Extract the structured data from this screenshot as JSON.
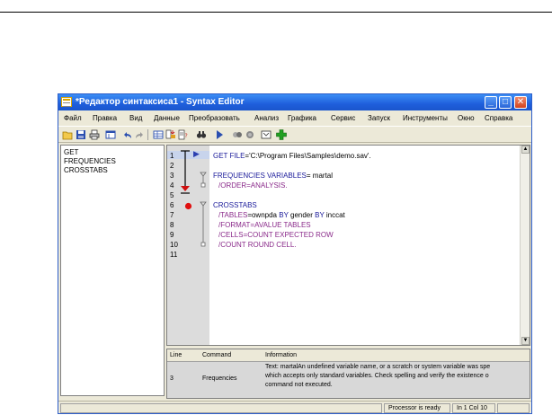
{
  "window": {
    "title": "*Редактор синтаксиса1 - Syntax Editor",
    "minimize": "_",
    "maximize": "□",
    "close": "✕"
  },
  "menu": [
    "Файл",
    "Правка",
    "Вид",
    "Данные",
    "Преобразовать",
    "Анализ",
    "Графика",
    "Сервис",
    "Запуск",
    "Инструменты",
    "Окно",
    "Справка"
  ],
  "toolbar_icons": [
    "open-icon",
    "save-icon",
    "print-icon",
    "dialog-recall-icon",
    "undo-icon",
    "redo-icon",
    "goto-data-icon",
    "goto-case-icon",
    "variables-icon",
    "find-icon",
    "run-icon",
    "step-icon",
    "breakpoint-icon",
    "bookmark-icon",
    "add-icon"
  ],
  "navigator": [
    "GET",
    "FREQUENCIES",
    "CROSSTABS"
  ],
  "editor": {
    "line_numbers": [
      "1",
      "2",
      "3",
      "4",
      "5",
      "6",
      "7",
      "8",
      "9",
      "10",
      "11"
    ],
    "lines": [
      {
        "kw": "GET FILE",
        "rest": "='C:\\Program Files\\Samples\\demo.sav'."
      },
      {
        "kw": "FREQUENCIES VARIABLES",
        "rest": "= martal"
      },
      {
        "kw": "/ORDER",
        "rest": "=ANALYSIS."
      },
      {
        "kw": "CROSSTABS",
        "rest": ""
      },
      {
        "kw": "/TABLES",
        "rest": "=ownpda ",
        "kw2": "BY",
        "rest2": " gender ",
        "kw3": "BY",
        "rest3": " inccat"
      },
      {
        "kw": "/FORMAT",
        "rest": "=AVALUE TABLES"
      },
      {
        "kw": "/CELLS",
        "rest": "=COUNT EXPECTED ROW"
      },
      {
        "kw": "/COUNT",
        "rest": " ROUND CELL."
      }
    ],
    "step_pointer": "▶",
    "breakpoint_line": "6"
  },
  "messages": {
    "headers": [
      "Line",
      "Command",
      "Information"
    ],
    "row": {
      "line": "3",
      "command": "Frequencies",
      "info": [
        "Text: martalAn undefined variable name, or a scratch or system variable was spe",
        "which accepts only standard variables.  Check spelling and verify the existence o",
        "command not executed."
      ]
    }
  },
  "status": {
    "processor": "Processor is ready",
    "position": "In 1 Col 10"
  },
  "colors": {
    "title_bar": "#1f5fdc",
    "keyword": "#1a1a9a",
    "subcommand": "#8a2a8a",
    "breakpoint": "#e01010"
  }
}
